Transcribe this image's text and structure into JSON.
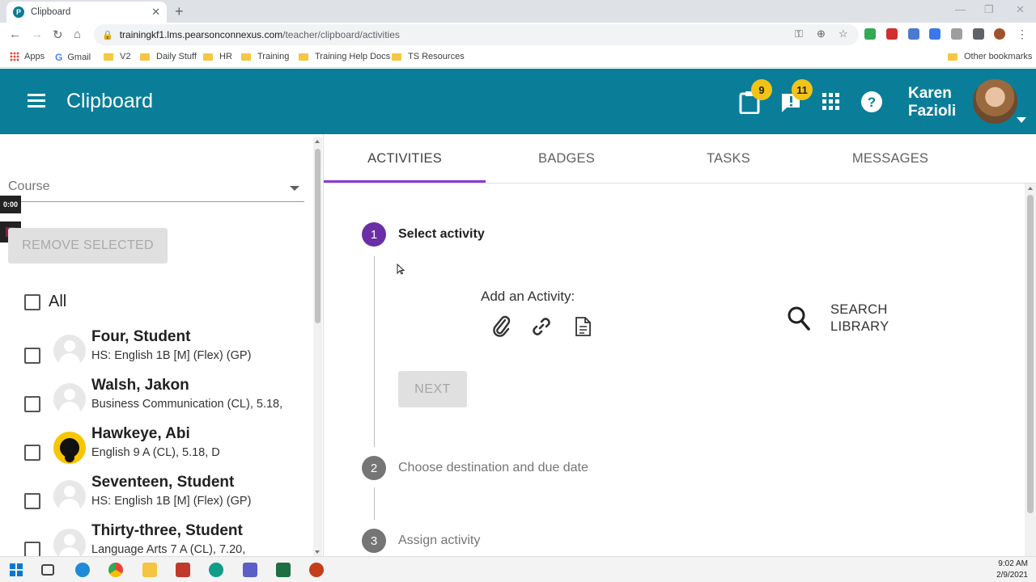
{
  "browser": {
    "tab_title": "Clipboard",
    "url_host": "trainingkf1.lms.pearsonconnexus.com",
    "url_path": "/teacher/clipboard/activities",
    "bookmarks": [
      "Apps",
      "Gmail",
      "V2",
      "Daily Stuff",
      "HR",
      "Training",
      "Training Help Docs",
      "TS Resources"
    ],
    "other_bookmarks": "Other bookmarks"
  },
  "header": {
    "title": "Clipboard",
    "clipboard_count": "9",
    "alerts_count": "11",
    "user_first": "Karen",
    "user_last": "Fazioli"
  },
  "sidebar": {
    "course_placeholder": "Course",
    "recording_time": "0:00",
    "remove_label": "REMOVE SELECTED",
    "all_label": "All",
    "students": [
      {
        "name": "Four, Student",
        "class": "HS: English 1B [M] (Flex) (GP)"
      },
      {
        "name": "Walsh, Jakon",
        "class": "Business Communication (CL), 5.18,"
      },
      {
        "name": "Hawkeye, Abi",
        "class": "English 9 A (CL), 5.18, D"
      },
      {
        "name": "Seventeen, Student",
        "class": "HS: English 1B [M] (Flex) (GP)"
      },
      {
        "name": "Thirty-three, Student",
        "class": "Language Arts 7 A (CL), 7.20,"
      }
    ]
  },
  "tabs": [
    "ACTIVITIES",
    "BADGES",
    "TASKS",
    "MESSAGES"
  ],
  "steps": [
    {
      "num": "1",
      "label": "Select activity"
    },
    {
      "num": "2",
      "label": "Choose destination and due date"
    },
    {
      "num": "3",
      "label": "Assign activity"
    }
  ],
  "activity": {
    "add_label": "Add an Activity:",
    "search_line1": "SEARCH",
    "search_line2": "LIBRARY",
    "next_label": "NEXT"
  },
  "taskbar": {
    "time": "9:02 AM",
    "date": "2/9/2021"
  },
  "colors": {
    "appbar": "#0a7e98",
    "step_active": "#6a2fa5",
    "tab_ink": "#8a3ccf",
    "badge": "#f3c318"
  }
}
